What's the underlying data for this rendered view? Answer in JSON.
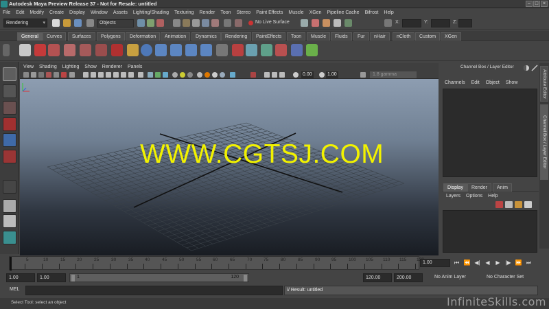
{
  "window": {
    "title": "Autodesk Maya Preview Release 37 - Not for Resale: untitled"
  },
  "menubar": [
    "File",
    "Edit",
    "Modify",
    "Create",
    "Display",
    "Window",
    "Assets",
    "Lighting/Shading",
    "Texturing",
    "Render",
    "Toon",
    "Stereo",
    "Paint Effects",
    "Muscle",
    "XGen",
    "Pipeline Cache",
    "Bifrost",
    "Help"
  ],
  "statusline": {
    "mode": "Rendering",
    "selection_mode": "Objects",
    "live_surface": "No Live Surface",
    "x_label": "X:",
    "y_label": "Y:",
    "z_label": "Z:"
  },
  "shelf": {
    "tabs": [
      "General",
      "Curves",
      "Surfaces",
      "Polygons",
      "Deformation",
      "Animation",
      "Dynamics",
      "Rendering",
      "PaintEffects",
      "Toon",
      "Muscle",
      "Fluids",
      "Fur",
      "nHair",
      "nCloth",
      "Custom",
      "XGen"
    ],
    "active_tab": "General",
    "icons": [
      "render-view-icon",
      "help-icon",
      "render-icon",
      "ipr-render-icon",
      "render-settings-icon",
      "hypershade-icon",
      "sphere-icon",
      "render-layer-icon",
      "render-layer-icon",
      "render-layer-icon",
      "render-layer-icon",
      "render-layer-icon",
      "render-view-icon",
      "light-icon",
      "shader-icon",
      "texture-icon",
      "paint-icon",
      "transform-icon",
      "move-icon"
    ]
  },
  "viewport": {
    "menu": [
      "View",
      "Shading",
      "Lighting",
      "Show",
      "Renderer",
      "Panels"
    ],
    "exposure": "0.00",
    "gamma_value": "1.00",
    "color_space": "1.8 gamma",
    "watermark": "WWW.CGTSJ.COM"
  },
  "channel_box": {
    "title": "Channel Box / Layer Editor",
    "menu": [
      "Channels",
      "Edit",
      "Object",
      "Show"
    ],
    "side_tabs": [
      "Attribute Editor",
      "Channel Box / Layer Editor"
    ]
  },
  "layer_editor": {
    "tabs": [
      "Display",
      "Render",
      "Anim"
    ],
    "active_tab": "Display",
    "menu": [
      "Layers",
      "Options",
      "Help"
    ]
  },
  "time_slider": {
    "ticks": [
      "5",
      "10",
      "15",
      "20",
      "25",
      "30",
      "35",
      "40",
      "45",
      "50",
      "55",
      "60",
      "65",
      "70",
      "75",
      "80",
      "85",
      "90",
      "95",
      "100",
      "105",
      "110",
      "115",
      "120"
    ],
    "current_frame": "1.00",
    "playback": [
      "go-start-icon",
      "step-back-key-icon",
      "step-back-frame-icon",
      "play-back-icon",
      "play-forward-icon",
      "step-forward-frame-icon",
      "step-forward-key-icon",
      "go-end-icon"
    ]
  },
  "range_slider": {
    "start_time": "1.00",
    "playback_start": "1.00",
    "range_start": "1",
    "range_end": "120",
    "playback_end": "120.00",
    "end_time": "200.00",
    "anim_layer": "No Anim Layer",
    "character_set": "No Character Set"
  },
  "command_line": {
    "language": "MEL",
    "result": "// Result: untitled"
  },
  "help_line": {
    "text": "Select Tool: select an object",
    "brand": "InfiniteSkills.com"
  }
}
